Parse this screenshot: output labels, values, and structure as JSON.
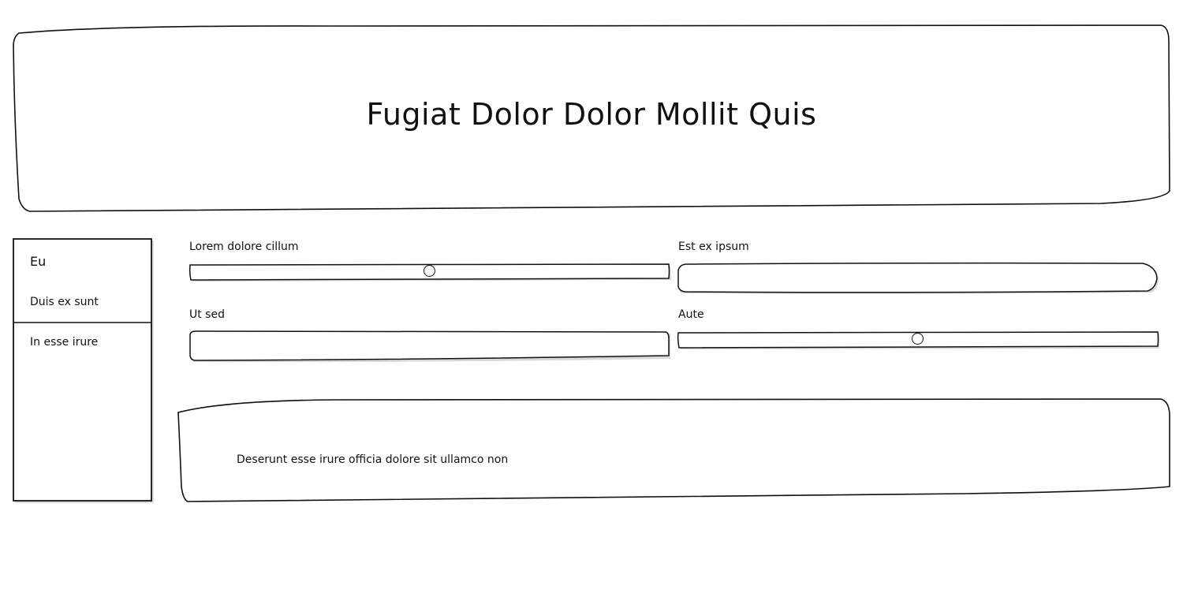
{
  "header": {
    "title": "Fugiat Dolor Dolor Mollit Quis"
  },
  "sidebar": {
    "heading": "Eu",
    "items": [
      {
        "label": "Duis ex sunt"
      },
      {
        "label": "In esse irure"
      }
    ]
  },
  "form": {
    "fields": [
      {
        "label": "Lorem dolore cillum",
        "type": "slider",
        "value": 0.5
      },
      {
        "label": "Est ex ipsum",
        "type": "text",
        "value": ""
      },
      {
        "label": "Ut sed",
        "type": "text",
        "value": ""
      },
      {
        "label": "Aute",
        "type": "slider",
        "value": 0.5
      }
    ]
  },
  "panel": {
    "text": "Deserunt esse irure officia dolore sit ullamco non"
  }
}
